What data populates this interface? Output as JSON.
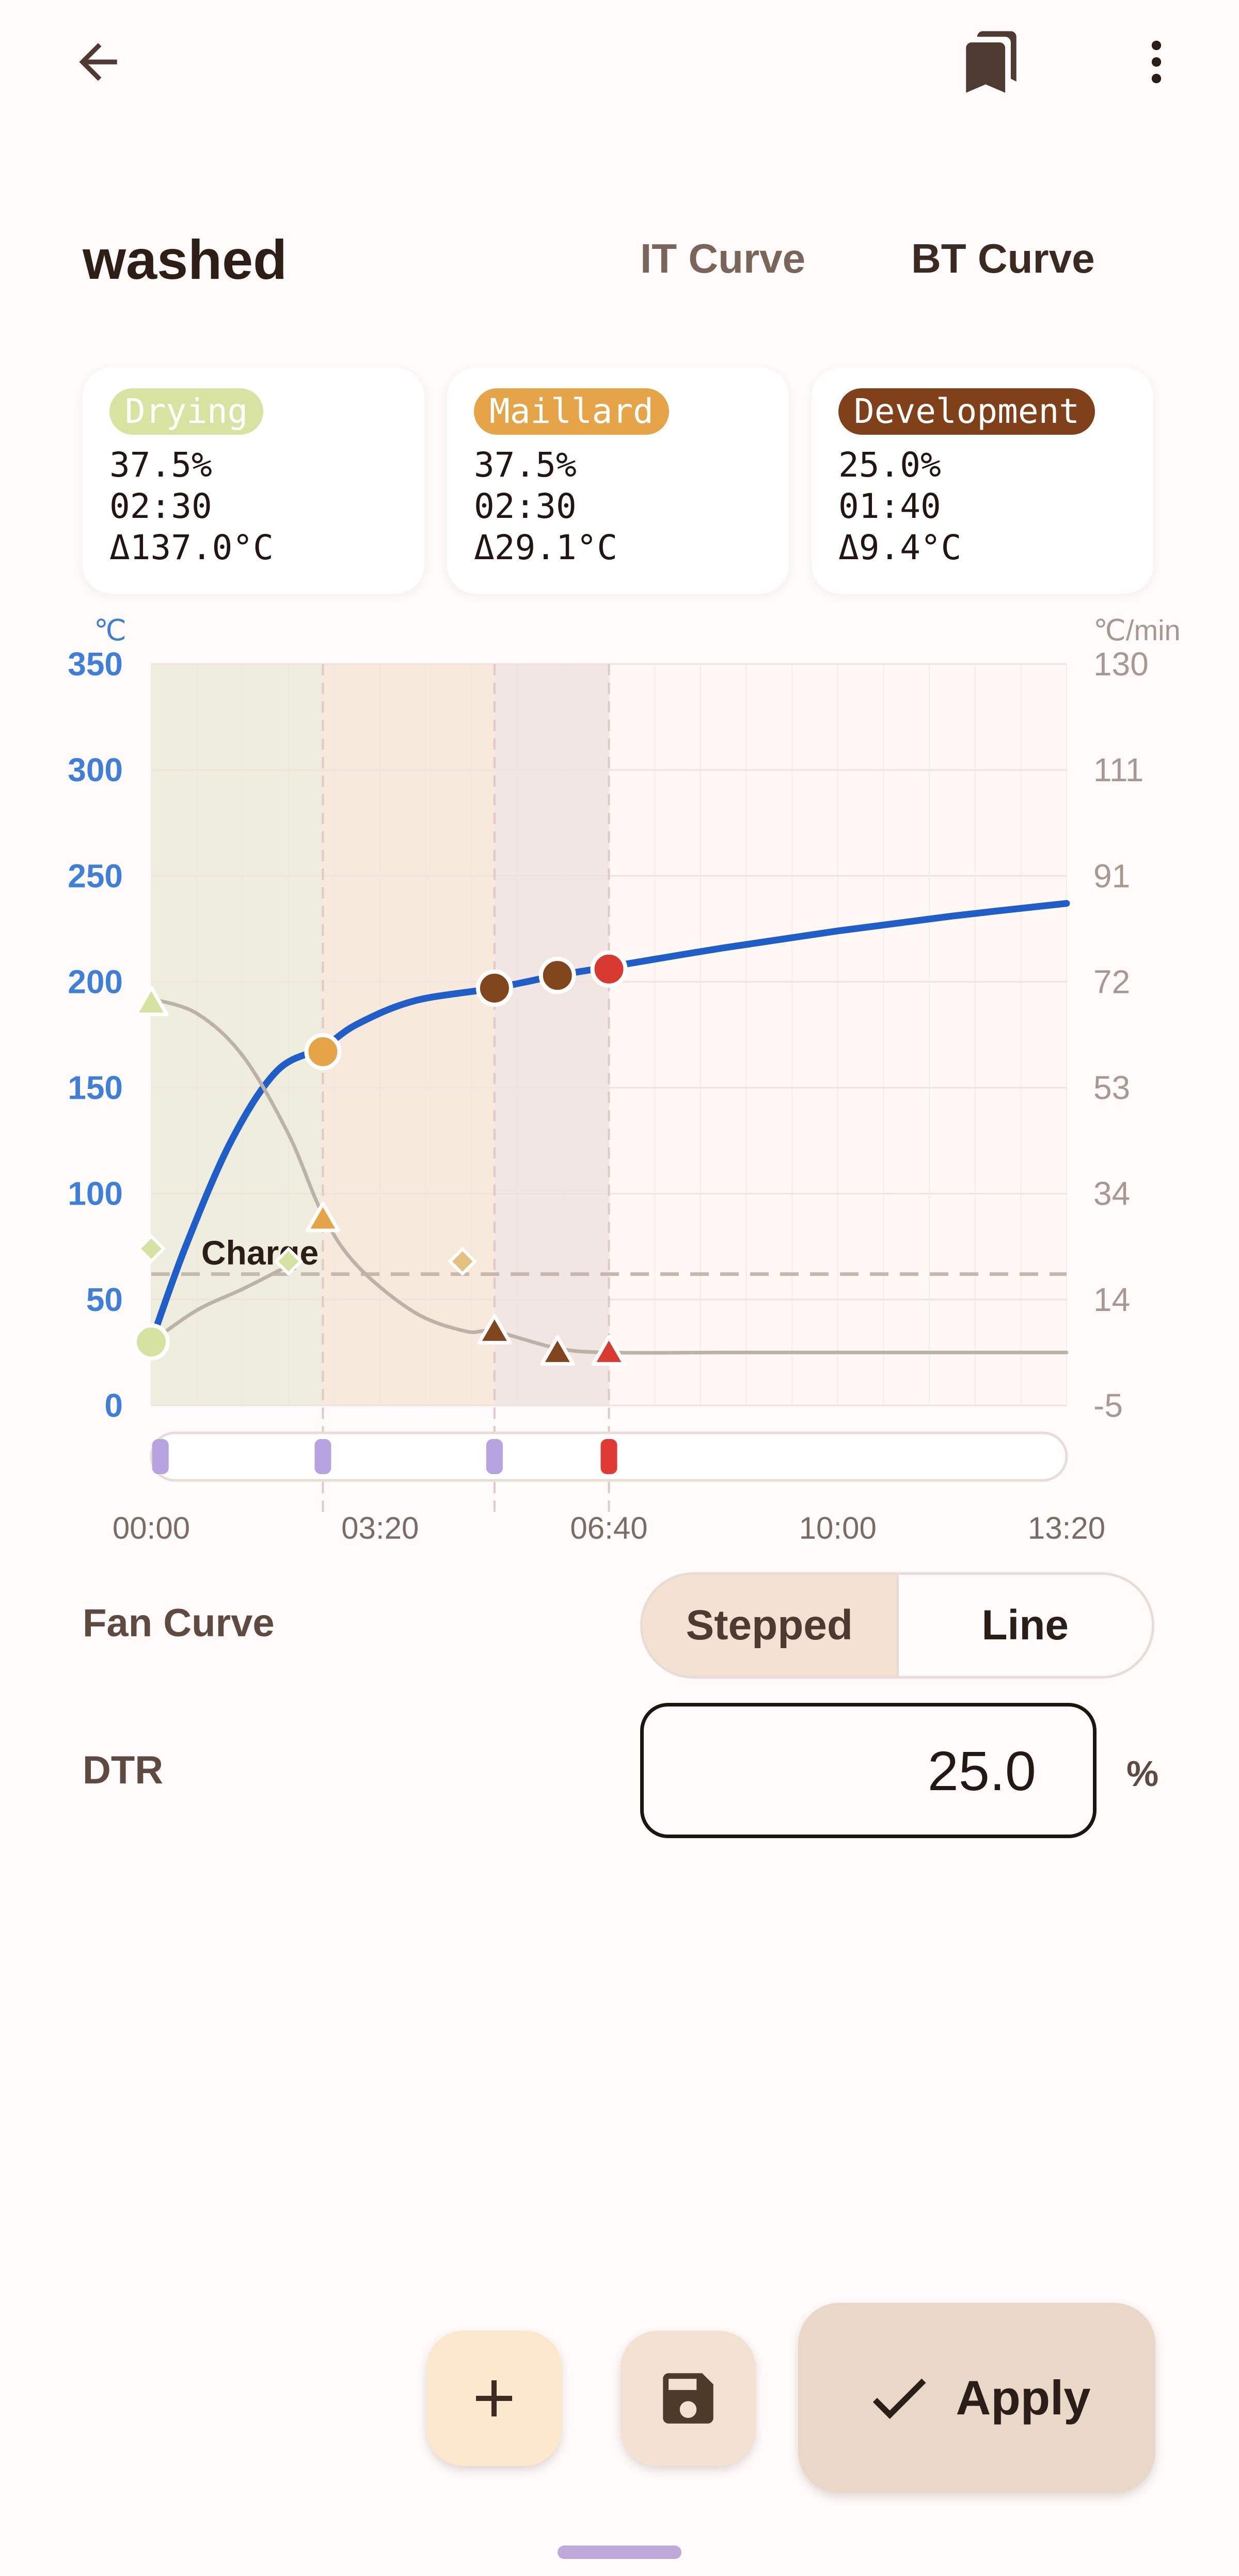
{
  "topbar": {
    "back_icon": "arrow-back-icon",
    "bookmarks_icon": "bookmarks-icon",
    "more_icon": "more-vertical-icon"
  },
  "profile": {
    "title": "washed",
    "tabs": [
      {
        "label": "IT Curve",
        "selected": false
      },
      {
        "label": "BT Curve",
        "selected": true
      }
    ]
  },
  "phases": [
    {
      "name": "Drying",
      "percent": "37.5%",
      "time": "02:30",
      "delta": "Δ137.0°C",
      "color": "#D8E3A2"
    },
    {
      "name": "Maillard",
      "percent": "37.5%",
      "time": "02:30",
      "delta": "Δ29.1°C",
      "color": "#E4A447"
    },
    {
      "name": "Development",
      "percent": "25.0%",
      "time": "01:40",
      "delta": "Δ9.4°C",
      "color": "#80411A"
    }
  ],
  "chart_data": {
    "type": "line",
    "left_axis_unit": "℃",
    "right_axis_unit": "℃/min",
    "left_ticks": [
      350,
      300,
      250,
      200,
      150,
      100,
      50,
      0
    ],
    "right_ticks": [
      130,
      111,
      91,
      72,
      53,
      34,
      14,
      -5
    ],
    "x_ticks": [
      "00:00",
      "03:20",
      "06:40",
      "10:00",
      "13:20"
    ],
    "xlim_seconds": [
      0,
      800
    ],
    "ylim_temp": [
      0,
      350
    ],
    "ylim_ror": [
      -5,
      130
    ],
    "grid": true,
    "phase_regions": [
      {
        "name": "Drying",
        "start": 0,
        "end": 150,
        "color": "#ECEBD8"
      },
      {
        "name": "Maillard",
        "start": 150,
        "end": 300,
        "color": "#F7E6D8"
      },
      {
        "name": "Development",
        "start": 300,
        "end": 400,
        "color": "#EFE3E1"
      }
    ],
    "annotation": "Charge",
    "series": [
      {
        "name": "BT",
        "color": "#1F5EC9",
        "axis": "temp",
        "points": [
          [
            0,
            30
          ],
          [
            30,
            75
          ],
          [
            70,
            125
          ],
          [
            110,
            158
          ],
          [
            150,
            169
          ],
          [
            180,
            180
          ],
          [
            230,
            191
          ],
          [
            300,
            197
          ],
          [
            355,
            203
          ],
          [
            400,
            207
          ],
          [
            500,
            216
          ],
          [
            600,
            224
          ],
          [
            700,
            231
          ],
          [
            800,
            237
          ]
        ]
      },
      {
        "name": "RoR",
        "color": "#BCB2A8",
        "axis": "temp",
        "points": [
          [
            0,
            192
          ],
          [
            40,
            185
          ],
          [
            80,
            165
          ],
          [
            120,
            128
          ],
          [
            150,
            90
          ],
          [
            180,
            66
          ],
          [
            230,
            44
          ],
          [
            275,
            35
          ],
          [
            300,
            35
          ],
          [
            355,
            27
          ],
          [
            400,
            25
          ],
          [
            500,
            25
          ],
          [
            600,
            25
          ],
          [
            700,
            25
          ],
          [
            800,
            25
          ]
        ]
      },
      {
        "name": "IT",
        "color": "#BCB2A8",
        "axis": "temp",
        "points": [
          [
            0,
            30
          ],
          [
            40,
            45
          ],
          [
            80,
            55
          ],
          [
            120,
            66
          ]
        ]
      }
    ],
    "reference_line": {
      "value": 62,
      "axis": "temp",
      "color": "#C6B8AE"
    },
    "markers_bt": [
      {
        "t": 0,
        "v": 30,
        "color": "#D6E2A1"
      },
      {
        "t": 150,
        "v": 167,
        "color": "#E4A447"
      },
      {
        "t": 300,
        "v": 197,
        "color": "#82461F"
      },
      {
        "t": 355,
        "v": 203,
        "color": "#82461F"
      },
      {
        "t": 400,
        "v": 206,
        "color": "#D93A30"
      }
    ],
    "markers_ror": [
      {
        "t": 0,
        "v": 190,
        "color": "#D6E2A1"
      },
      {
        "t": 150,
        "v": 88,
        "color": "#E4A447"
      },
      {
        "t": 300,
        "v": 35,
        "color": "#82461F"
      },
      {
        "t": 355,
        "v": 25,
        "color": "#82461F"
      },
      {
        "t": 400,
        "v": 25,
        "color": "#D93A30"
      }
    ],
    "markers_diamond": [
      {
        "t": 0,
        "v": 74,
        "color": "#D6E2A1"
      },
      {
        "t": 120,
        "v": 68,
        "color": "#D6E2A1"
      },
      {
        "t": 272,
        "v": 68,
        "color": "#E4C081"
      }
    ],
    "event_markers": [
      {
        "t": 8,
        "color": "#B6A3E0"
      },
      {
        "t": 150,
        "color": "#B6A3E0"
      },
      {
        "t": 300,
        "color": "#B6A3E0"
      },
      {
        "t": 400,
        "color": "#E03A34"
      }
    ]
  },
  "fan_curve": {
    "label": "Fan Curve",
    "options": [
      {
        "label": "Stepped",
        "selected": true
      },
      {
        "label": "Line",
        "selected": false
      }
    ]
  },
  "dtr": {
    "label": "DTR",
    "value": "25.0",
    "unit": "%"
  },
  "actions": {
    "add_icon": "plus-icon",
    "save_icon": "save-icon",
    "apply_icon": "check-icon",
    "apply_label": "Apply"
  }
}
